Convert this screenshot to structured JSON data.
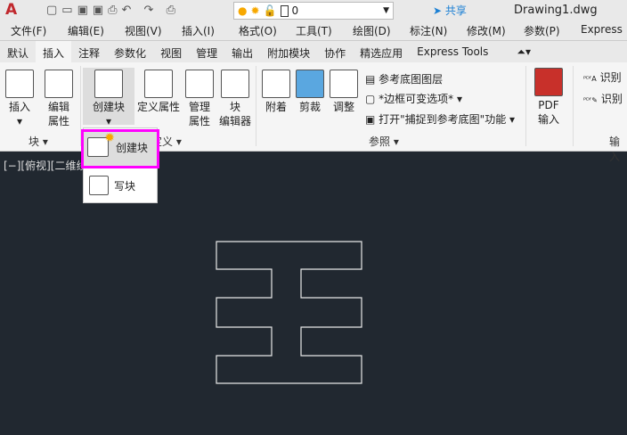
{
  "title_bar": {
    "app_icon": "autocad-logo-icon",
    "layer_value": "0",
    "share_label": "共享",
    "document_title": "Drawing1.dwg",
    "icons": [
      "new-icon",
      "open-icon",
      "save-icon",
      "save-as-icon",
      "print-icon",
      "undo-icon",
      "redo-icon",
      "plot-icon",
      "bulb-icon",
      "sun-icon",
      "lock-icon"
    ]
  },
  "menu": [
    "文件(F)",
    "编辑(E)",
    "视图(V)",
    "插入(I)",
    "格式(O)",
    "工具(T)",
    "绘图(D)",
    "标注(N)",
    "修改(M)",
    "参数(P)",
    "Express"
  ],
  "tabs": [
    "默认",
    "插入",
    "注释",
    "参数化",
    "视图",
    "管理",
    "输出",
    "附加模块",
    "协作",
    "精选应用",
    "Express Tools"
  ],
  "active_tab": "插入",
  "ribbon": {
    "insert": "插入",
    "edit_attr_1": "编辑",
    "edit_attr_2": "属性",
    "create_block": "创建块",
    "define_attr": "定义属性",
    "manage_attr_1": "管理",
    "manage_attr_2": "属性",
    "block_editor_1": "块",
    "block_editor_2": "编辑器",
    "attach": "附着",
    "clip": "剪裁",
    "adjust": "调整",
    "underlay_layers": "参考底图图层",
    "frame_options": "*边框可变选项*",
    "snap_underlay": "打开\"捕捉到参考底图\"功能",
    "pdf_1": "PDF",
    "pdf_2": "输入",
    "recognize_1": "识别",
    "recognize_2": "识别",
    "panel_block": "块",
    "panel_define": "定义",
    "panel_reference": "参照",
    "panel_import": "输入"
  },
  "dropdown": {
    "items": [
      "创建块",
      "写块"
    ],
    "highlight_color": "#ff00ff"
  },
  "canvas": {
    "viewport_label": "[−][俯视][二维线",
    "background": "#212830"
  }
}
